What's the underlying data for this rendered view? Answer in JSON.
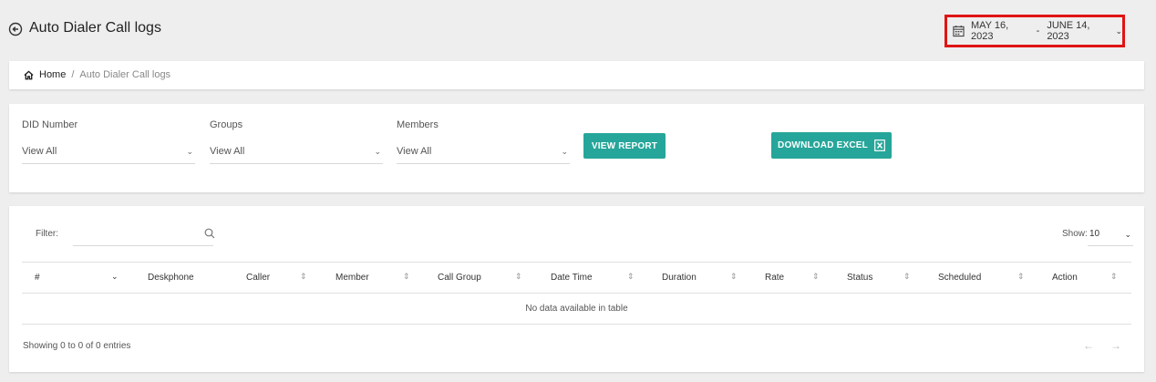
{
  "header": {
    "title": "Auto Dialer Call logs",
    "date_from": "MAY 16, 2023",
    "date_separator": "-",
    "date_to": "JUNE 14, 2023",
    "highlight_color": "#e01414"
  },
  "breadcrumb": {
    "home": "Home",
    "separator": "/",
    "current": "Auto Dialer Call logs"
  },
  "filters": {
    "did_number": {
      "label": "DID Number",
      "value": "View All"
    },
    "groups": {
      "label": "Groups",
      "value": "View All"
    },
    "members": {
      "label": "Members",
      "value": "View All"
    },
    "view_report_label": "VIEW REPORT",
    "download_excel_label": "DOWNLOAD EXCEL",
    "accent_color": "#26a69a"
  },
  "table": {
    "filter_label": "Filter:",
    "show_label": "Show:",
    "show_value": "10",
    "columns": [
      "#",
      "Deskphone",
      "Caller",
      "Member",
      "Call Group",
      "Date Time",
      "Duration",
      "Rate",
      "Status",
      "Scheduled",
      "Action"
    ],
    "empty_message": "No data available in table",
    "info": "Showing 0 to 0 of 0 entries",
    "prev_icon": "arrow-left-icon",
    "next_icon": "arrow-right-icon"
  },
  "icons": {
    "back": "circle-arrow-left-icon",
    "calendar": "calendar-icon",
    "home": "home-icon",
    "search": "search-icon",
    "excel": "excel-file-icon",
    "chevron": "chevron-down-icon",
    "sort": "sort-icon"
  }
}
